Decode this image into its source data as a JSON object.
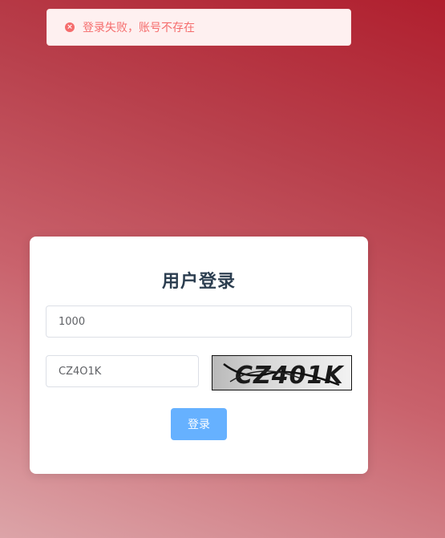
{
  "toast": {
    "message": "登录失败，账号不存在",
    "type": "error",
    "icon": "error-circle-icon",
    "color": "#f56c6c"
  },
  "login": {
    "title": "用户登录",
    "account_value": "1000",
    "captcha_value": "CZ4O1K",
    "captcha_image_text": "CZ401K",
    "submit_label": "登录",
    "button_color": "#66b1ff"
  }
}
